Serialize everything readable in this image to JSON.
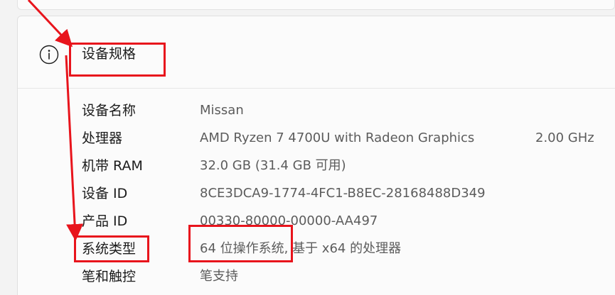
{
  "section": {
    "title": "设备规格"
  },
  "specs": [
    {
      "label": "设备名称",
      "value": "Missan"
    },
    {
      "label": "处理器",
      "value": "AMD Ryzen 7 4700U with Radeon Graphics",
      "extra": "2.00 GHz"
    },
    {
      "label": "机带 RAM",
      "value": "32.0 GB (31.4 GB 可用)"
    },
    {
      "label": "设备 ID",
      "value": "8CE3DCA9-1774-4FC1-B8EC-28168488D349"
    },
    {
      "label": "产品 ID",
      "value": "00330-80000-00000-AA497"
    },
    {
      "label": "系统类型",
      "value": "64 位操作系统, 基于 x64 的处理器"
    },
    {
      "label": "笔和触控",
      "value": "笔支持"
    }
  ],
  "icons": {
    "info": "info-icon"
  },
  "colors": {
    "annotation": "#e8141c",
    "label_text": "#1b1b1b",
    "value_text": "#5c5c5c"
  }
}
